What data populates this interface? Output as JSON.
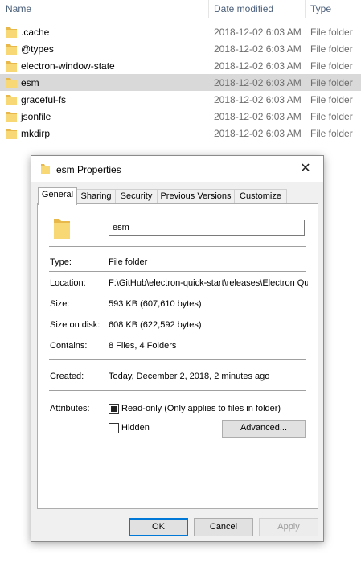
{
  "explorer": {
    "columns": {
      "name": "Name",
      "date": "Date modified",
      "type": "Type"
    },
    "rows": [
      {
        "name": ".cache",
        "date": "2018-12-02 6:03 AM",
        "type": "File folder"
      },
      {
        "name": "@types",
        "date": "2018-12-02 6:03 AM",
        "type": "File folder"
      },
      {
        "name": "electron-window-state",
        "date": "2018-12-02 6:03 AM",
        "type": "File folder"
      },
      {
        "name": "esm",
        "date": "2018-12-02 6:03 AM",
        "type": "File folder"
      },
      {
        "name": "graceful-fs",
        "date": "2018-12-02 6:03 AM",
        "type": "File folder"
      },
      {
        "name": "jsonfile",
        "date": "2018-12-02 6:03 AM",
        "type": "File folder"
      },
      {
        "name": "mkdirp",
        "date": "2018-12-02 6:03 AM",
        "type": "File folder"
      }
    ],
    "selected_row": "esm"
  },
  "dialog": {
    "title": "esm Properties",
    "close_glyph": "✕",
    "tabs": [
      "General",
      "Sharing",
      "Security",
      "Previous Versions",
      "Customize"
    ],
    "active_tab": "General",
    "name_value": "esm",
    "fields": {
      "type_label": "Type:",
      "type_value": "File folder",
      "location_label": "Location:",
      "location_value": "F:\\GitHub\\electron-quick-start\\releases\\Electron Qu",
      "size_label": "Size:",
      "size_value": "593 KB (607,610 bytes)",
      "size_on_disk_label": "Size on disk:",
      "size_on_disk_value": "608 KB (622,592 bytes)",
      "contains_label": "Contains:",
      "contains_value": "8 Files, 4 Folders",
      "created_label": "Created:",
      "created_value": "Today, December 2, 2018, 2 minutes ago",
      "attributes_label": "Attributes:"
    },
    "attributes": {
      "readonly_label": "Read-only (Only applies to files in folder)",
      "readonly_state": "indeterminate",
      "hidden_label": "Hidden",
      "hidden_state": "unchecked",
      "advanced_label": "Advanced..."
    },
    "buttons": {
      "ok": "OK",
      "cancel": "Cancel",
      "apply": "Apply"
    }
  },
  "colors": {
    "folder_yellow": "#f8d775",
    "selection": "#d9d9d9",
    "accent": "#0078d7"
  }
}
